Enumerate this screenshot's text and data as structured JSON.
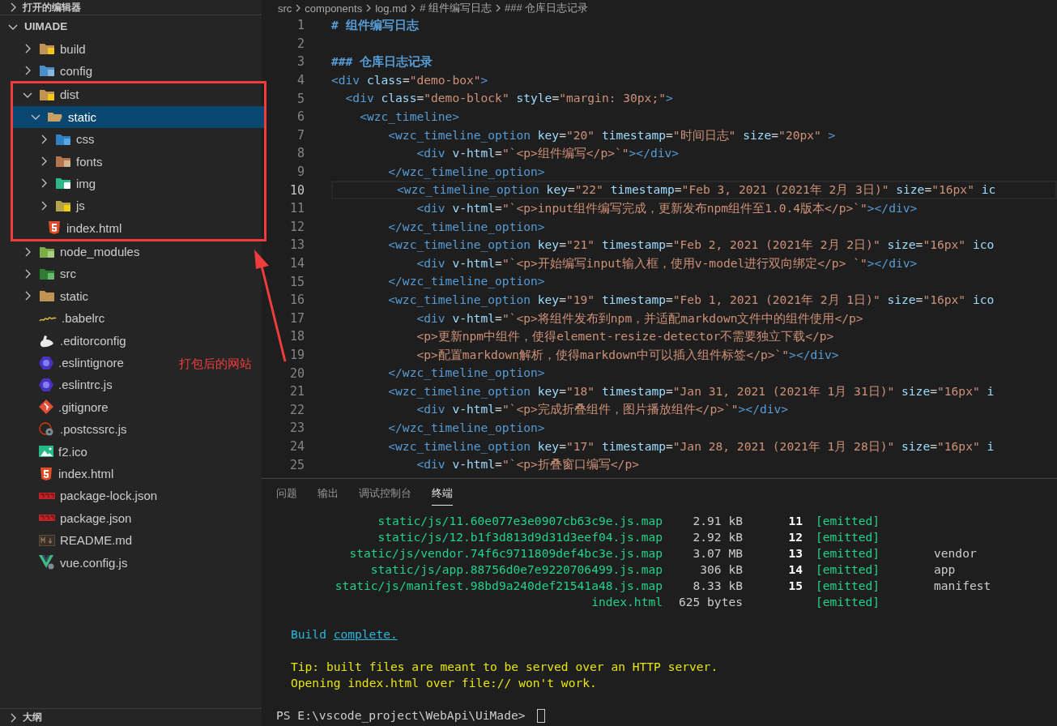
{
  "explorer": {
    "open_editors": {
      "title": "打开的编辑器",
      "expanded": false
    },
    "root": {
      "label": "UIMADE",
      "expanded": true,
      "children": [
        {
          "label": "build",
          "kind": "folder",
          "expanded": false,
          "selected": false,
          "annotated": false
        },
        {
          "label": "config",
          "kind": "folder",
          "expanded": false,
          "selected": false,
          "annotated": false
        },
        {
          "label": "dist",
          "kind": "folder",
          "expanded": true,
          "selected": false,
          "annotated": true,
          "children": [
            {
              "label": "static",
              "kind": "folder",
              "expanded": true,
              "selected": true,
              "children": [
                {
                  "label": "css",
                  "kind": "folder",
                  "expanded": false,
                  "selected": false
                },
                {
                  "label": "fonts",
                  "kind": "folder",
                  "expanded": false,
                  "selected": false
                },
                {
                  "label": "img",
                  "kind": "folder",
                  "expanded": false,
                  "selected": false
                },
                {
                  "label": "js",
                  "kind": "folder",
                  "expanded": false,
                  "selected": false
                }
              ]
            },
            {
              "label": "index.html",
              "kind": "file",
              "selected": false
            }
          ]
        },
        {
          "label": "node_modules",
          "kind": "folder",
          "expanded": false,
          "selected": false,
          "annotated": false
        },
        {
          "label": "src",
          "kind": "folder",
          "expanded": false,
          "selected": false,
          "annotated": false
        },
        {
          "label": "static",
          "kind": "folder",
          "expanded": false,
          "selected": false,
          "annotated": false
        },
        {
          "label": ".babelrc",
          "kind": "file",
          "selected": false,
          "annotated": false
        },
        {
          "label": ".editorconfig",
          "kind": "file",
          "selected": false,
          "annotated": false
        },
        {
          "label": ".eslintignore",
          "kind": "file",
          "selected": false,
          "annotated": false
        },
        {
          "label": ".eslintrc.js",
          "kind": "file",
          "selected": false,
          "annotated": false
        },
        {
          "label": ".gitignore",
          "kind": "file",
          "selected": false,
          "annotated": false
        },
        {
          "label": ".postcssrc.js",
          "kind": "file",
          "selected": false,
          "annotated": false
        },
        {
          "label": "f2.ico",
          "kind": "file",
          "selected": false,
          "annotated": false
        },
        {
          "label": "index.html",
          "kind": "file",
          "selected": false,
          "annotated": false
        },
        {
          "label": "package-lock.json",
          "kind": "file",
          "selected": false,
          "annotated": false
        },
        {
          "label": "package.json",
          "kind": "file",
          "selected": false,
          "annotated": false
        },
        {
          "label": "README.md",
          "kind": "file",
          "selected": false,
          "annotated": false
        },
        {
          "label": "vue.config.js",
          "kind": "file",
          "selected": false,
          "annotated": false
        }
      ]
    },
    "outline": {
      "title": "大纲",
      "expanded": false
    }
  },
  "annotation": {
    "text": "打包后的网站"
  },
  "editor": {
    "breadcrumbs": [
      "src",
      "components",
      "log.md",
      "# 组件编写日志",
      "### 仓库日志记录"
    ],
    "lines": [
      {
        "number": "1",
        "active": false,
        "segments": [
          {
            "kind": "heading",
            "text": "# 组件编写日志"
          }
        ]
      },
      {
        "number": "2",
        "active": false
      },
      {
        "number": "3",
        "active": false,
        "segments": [
          {
            "kind": "heading",
            "text": "### 仓库日志记录"
          }
        ]
      },
      {
        "number": "4",
        "active": false,
        "segments": [
          {
            "kind": "tag",
            "text": "<div"
          },
          {
            "kind": "attr",
            "text": " class"
          },
          {
            "kind": "eq",
            "text": "="
          },
          {
            "kind": "str",
            "text": "\"demo-box\""
          },
          {
            "kind": "tag",
            "text": ">"
          }
        ]
      },
      {
        "number": "5",
        "active": false,
        "segments": [
          {
            "kind": "tag",
            "text": "  <div"
          },
          {
            "kind": "attr",
            "text": " class"
          },
          {
            "kind": "eq",
            "text": "="
          },
          {
            "kind": "str",
            "text": "\"demo-block\""
          },
          {
            "kind": "attr",
            "text": " style"
          },
          {
            "kind": "eq",
            "text": "="
          },
          {
            "kind": "str",
            "text": "\"margin: 30px;\""
          },
          {
            "kind": "tag",
            "text": ">"
          }
        ]
      },
      {
        "number": "6",
        "active": false,
        "segments": [
          {
            "kind": "tag",
            "text": "    <wzc_timeline>"
          }
        ]
      },
      {
        "number": "7",
        "active": false,
        "segments": [
          {
            "kind": "tag",
            "text": "        <wzc_timeline_option"
          },
          {
            "kind": "attr",
            "text": " key"
          },
          {
            "kind": "eq",
            "text": "="
          },
          {
            "kind": "str",
            "text": "\"20\""
          },
          {
            "kind": "attr",
            "text": " timestamp"
          },
          {
            "kind": "eq",
            "text": "="
          },
          {
            "kind": "str",
            "text": "\"时间日志\""
          },
          {
            "kind": "attr",
            "text": " size"
          },
          {
            "kind": "eq",
            "text": "="
          },
          {
            "kind": "str",
            "text": "\"20px\""
          },
          {
            "kind": "tag",
            "text": " >"
          }
        ]
      },
      {
        "number": "8",
        "active": false,
        "segments": [
          {
            "kind": "tag",
            "text": "            <div"
          },
          {
            "kind": "attr",
            "text": " v-html"
          },
          {
            "kind": "eq",
            "text": "="
          },
          {
            "kind": "str",
            "text": "\"`<p>组件编写</p>`\""
          },
          {
            "kind": "tag",
            "text": "></div>"
          }
        ]
      },
      {
        "number": "9",
        "active": false,
        "segments": [
          {
            "kind": "tag",
            "text": "        </wzc_timeline_option>"
          }
        ]
      },
      {
        "number": "10",
        "active": true,
        "segments": [
          {
            "kind": "tag",
            "text": "         <wzc_timeline_option"
          },
          {
            "kind": "attr",
            "text": " key"
          },
          {
            "kind": "eq",
            "text": "="
          },
          {
            "kind": "str",
            "text": "\"22\""
          },
          {
            "kind": "attr",
            "text": " timestamp"
          },
          {
            "kind": "eq",
            "text": "="
          },
          {
            "kind": "str",
            "text": "\"Feb 3, 2021 (2021年 2月 3日)\""
          },
          {
            "kind": "attr",
            "text": " size"
          },
          {
            "kind": "eq",
            "text": "="
          },
          {
            "kind": "str",
            "text": "\"16px\""
          },
          {
            "kind": "attr",
            "text": " ic"
          }
        ]
      },
      {
        "number": "11",
        "active": false,
        "segments": [
          {
            "kind": "tag",
            "text": "            <div"
          },
          {
            "kind": "attr",
            "text": " v-html"
          },
          {
            "kind": "eq",
            "text": "="
          },
          {
            "kind": "str",
            "text": "\"`<p>input组件编写完成，更新发布npm组件至1.0.4版本</p>`\""
          },
          {
            "kind": "tag",
            "text": "></div>"
          }
        ]
      },
      {
        "number": "12",
        "active": false,
        "segments": [
          {
            "kind": "tag",
            "text": "        </wzc_timeline_option>"
          }
        ]
      },
      {
        "number": "13",
        "active": false,
        "segments": [
          {
            "kind": "tag",
            "text": "        <wzc_timeline_option"
          },
          {
            "kind": "attr",
            "text": " key"
          },
          {
            "kind": "eq",
            "text": "="
          },
          {
            "kind": "str",
            "text": "\"21\""
          },
          {
            "kind": "attr",
            "text": " timestamp"
          },
          {
            "kind": "eq",
            "text": "="
          },
          {
            "kind": "str",
            "text": "\"Feb 2, 2021 (2021年 2月 2日)\""
          },
          {
            "kind": "attr",
            "text": " size"
          },
          {
            "kind": "eq",
            "text": "="
          },
          {
            "kind": "str",
            "text": "\"16px\""
          },
          {
            "kind": "attr",
            "text": " ico"
          }
        ]
      },
      {
        "number": "14",
        "active": false,
        "segments": [
          {
            "kind": "tag",
            "text": "            <div"
          },
          {
            "kind": "attr",
            "text": " v-html"
          },
          {
            "kind": "eq",
            "text": "="
          },
          {
            "kind": "str",
            "text": "\"`<p>开始编写input输入框，使用v-model进行双向绑定</p> `\""
          },
          {
            "kind": "tag",
            "text": "></div>"
          }
        ]
      },
      {
        "number": "15",
        "active": false,
        "segments": [
          {
            "kind": "tag",
            "text": "        </wzc_timeline_option>"
          }
        ]
      },
      {
        "number": "16",
        "active": false,
        "segments": [
          {
            "kind": "tag",
            "text": "        <wzc_timeline_option"
          },
          {
            "kind": "attr",
            "text": " key"
          },
          {
            "kind": "eq",
            "text": "="
          },
          {
            "kind": "str",
            "text": "\"19\""
          },
          {
            "kind": "attr",
            "text": " timestamp"
          },
          {
            "kind": "eq",
            "text": "="
          },
          {
            "kind": "str",
            "text": "\"Feb 1, 2021 (2021年 2月 1日)\""
          },
          {
            "kind": "attr",
            "text": " size"
          },
          {
            "kind": "eq",
            "text": "="
          },
          {
            "kind": "str",
            "text": "\"16px\""
          },
          {
            "kind": "attr",
            "text": " ico"
          }
        ]
      },
      {
        "number": "17",
        "active": false,
        "segments": [
          {
            "kind": "tag",
            "text": "            <div"
          },
          {
            "kind": "attr",
            "text": " v-html"
          },
          {
            "kind": "eq",
            "text": "="
          },
          {
            "kind": "str",
            "text": "\"`<p>将组件发布到npm，并适配markdown文件中的组件使用</p>"
          }
        ]
      },
      {
        "number": "18",
        "active": false,
        "segments": [
          {
            "kind": "str",
            "text": "            <p>更新npm中组件，使得element-resize-detector不需要独立下载</p>"
          }
        ]
      },
      {
        "number": "19",
        "active": false,
        "segments": [
          {
            "kind": "str",
            "text": "            <p>配置markdown解析，使得markdown中可以插入组件标签</p>`\""
          },
          {
            "kind": "tag",
            "text": "></div>"
          }
        ]
      },
      {
        "number": "20",
        "active": false,
        "segments": [
          {
            "kind": "tag",
            "text": "        </wzc_timeline_option>"
          }
        ]
      },
      {
        "number": "21",
        "active": false,
        "segments": [
          {
            "kind": "tag",
            "text": "        <wzc_timeline_option"
          },
          {
            "kind": "attr",
            "text": " key"
          },
          {
            "kind": "eq",
            "text": "="
          },
          {
            "kind": "str",
            "text": "\"18\""
          },
          {
            "kind": "attr",
            "text": " timestamp"
          },
          {
            "kind": "eq",
            "text": "="
          },
          {
            "kind": "str",
            "text": "\"Jan 31, 2021 (2021年 1月 31日)\""
          },
          {
            "kind": "attr",
            "text": " size"
          },
          {
            "kind": "eq",
            "text": "="
          },
          {
            "kind": "str",
            "text": "\"16px\""
          },
          {
            "kind": "attr",
            "text": " i"
          }
        ]
      },
      {
        "number": "22",
        "active": false,
        "segments": [
          {
            "kind": "tag",
            "text": "            <div"
          },
          {
            "kind": "attr",
            "text": " v-html"
          },
          {
            "kind": "eq",
            "text": "="
          },
          {
            "kind": "str",
            "text": "\"`<p>完成折叠组件，图片播放组件</p>`\""
          },
          {
            "kind": "tag",
            "text": "></div>"
          }
        ]
      },
      {
        "number": "23",
        "active": false,
        "segments": [
          {
            "kind": "tag",
            "text": "        </wzc_timeline_option>"
          }
        ]
      },
      {
        "number": "24",
        "active": false,
        "segments": [
          {
            "kind": "tag",
            "text": "        <wzc_timeline_option"
          },
          {
            "kind": "attr",
            "text": " key"
          },
          {
            "kind": "eq",
            "text": "="
          },
          {
            "kind": "str",
            "text": "\"17\""
          },
          {
            "kind": "attr",
            "text": " timestamp"
          },
          {
            "kind": "eq",
            "text": "="
          },
          {
            "kind": "str",
            "text": "\"Jan 28, 2021 (2021年 1月 28日)\""
          },
          {
            "kind": "attr",
            "text": " size"
          },
          {
            "kind": "eq",
            "text": "="
          },
          {
            "kind": "str",
            "text": "\"16px\""
          },
          {
            "kind": "attr",
            "text": " i"
          }
        ]
      },
      {
        "number": "25",
        "active": false,
        "segments": [
          {
            "kind": "tag",
            "text": "            <div"
          },
          {
            "kind": "attr",
            "text": " v-html"
          },
          {
            "kind": "eq",
            "text": "="
          },
          {
            "kind": "str",
            "text": "\"`<p>折叠窗口编写</p>"
          }
        ]
      }
    ]
  },
  "panel": {
    "tabs": [
      {
        "label": "问题",
        "selected": false
      },
      {
        "label": "输出",
        "selected": false
      },
      {
        "label": "调试控制台",
        "selected": false
      },
      {
        "label": "终端",
        "selected": true
      }
    ],
    "terminal": {
      "assets": [
        {
          "file": "static/js/11.60e077e3e0907cb63c9e.js.map",
          "size": "2.91 kB",
          "chunk": "11",
          "status": "[emitted]"
        },
        {
          "file": "static/js/12.b1f3d813d9d31d3eef04.js.map",
          "size": "2.92 kB",
          "chunk": "12",
          "status": "[emitted]"
        },
        {
          "file": "static/js/vendor.74f6c9711809def4bc3e.js.map",
          "size": "3.07 MB",
          "chunk": "13",
          "status": "[emitted]",
          "chunk_name": "vendor"
        },
        {
          "file": "static/js/app.88756d0e7e9220706499.js.map",
          "size": "306 kB",
          "chunk": "14",
          "status": "[emitted]",
          "chunk_name": "app"
        },
        {
          "file": "static/js/manifest.98bd9a240def21541a48.js.map",
          "size": "8.33 kB",
          "chunk": "15",
          "status": "[emitted]",
          "chunk_name": "manifest"
        },
        {
          "file": "index.html",
          "size": "625 bytes",
          "status": "[emitted]"
        }
      ],
      "build": {
        "text": "Build",
        "link": "complete."
      },
      "tip_lines": [
        "Tip: built files are meant to be served over an HTTP server.",
        "Opening index.html over file:// won't work."
      ],
      "prompt": "PS E:\\vscode_project\\WebApi\\UiMade>"
    }
  }
}
